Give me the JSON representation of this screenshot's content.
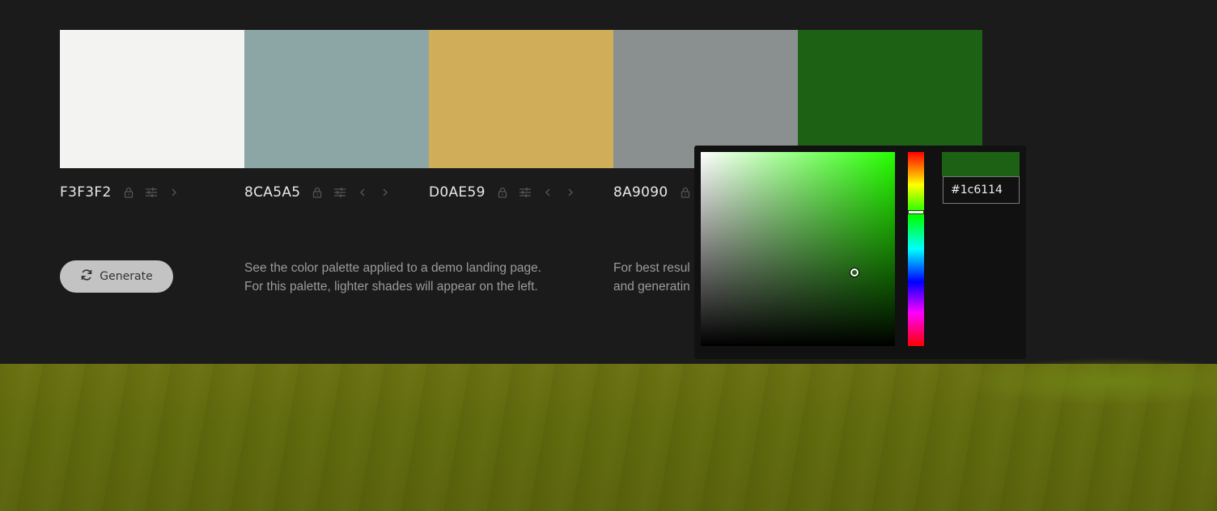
{
  "palette": [
    {
      "hex": "F3F3F2",
      "color": "#F3F3F2",
      "has_left_arrow": false
    },
    {
      "hex": "8CA5A5",
      "color": "#8CA5A5",
      "has_left_arrow": true
    },
    {
      "hex": "D0AE59",
      "color": "#D0AE59",
      "has_left_arrow": true
    },
    {
      "hex": "8A9090",
      "color": "#8A9090",
      "has_left_arrow": true
    },
    {
      "hex": "",
      "color": "#1C6114",
      "has_left_arrow": true
    }
  ],
  "icons": {
    "lock": "lock-icon",
    "adjust": "sliders-icon",
    "prev": "chevron-left-icon",
    "next": "chevron-right-icon",
    "refresh": "refresh-icon"
  },
  "generate": {
    "label": "Generate"
  },
  "descriptions": {
    "demo": {
      "line1": "See the color palette applied to a demo landing page.",
      "line2": "For this palette, lighter shades will appear on the left."
    },
    "tip": {
      "line1": "For best resul",
      "line2": "and generatin"
    }
  },
  "color_picker": {
    "value": "#1c6114",
    "hue_color": "#26ff00",
    "saturation": 0.79,
    "brightness": 0.38,
    "hue_fraction": 0.31
  }
}
